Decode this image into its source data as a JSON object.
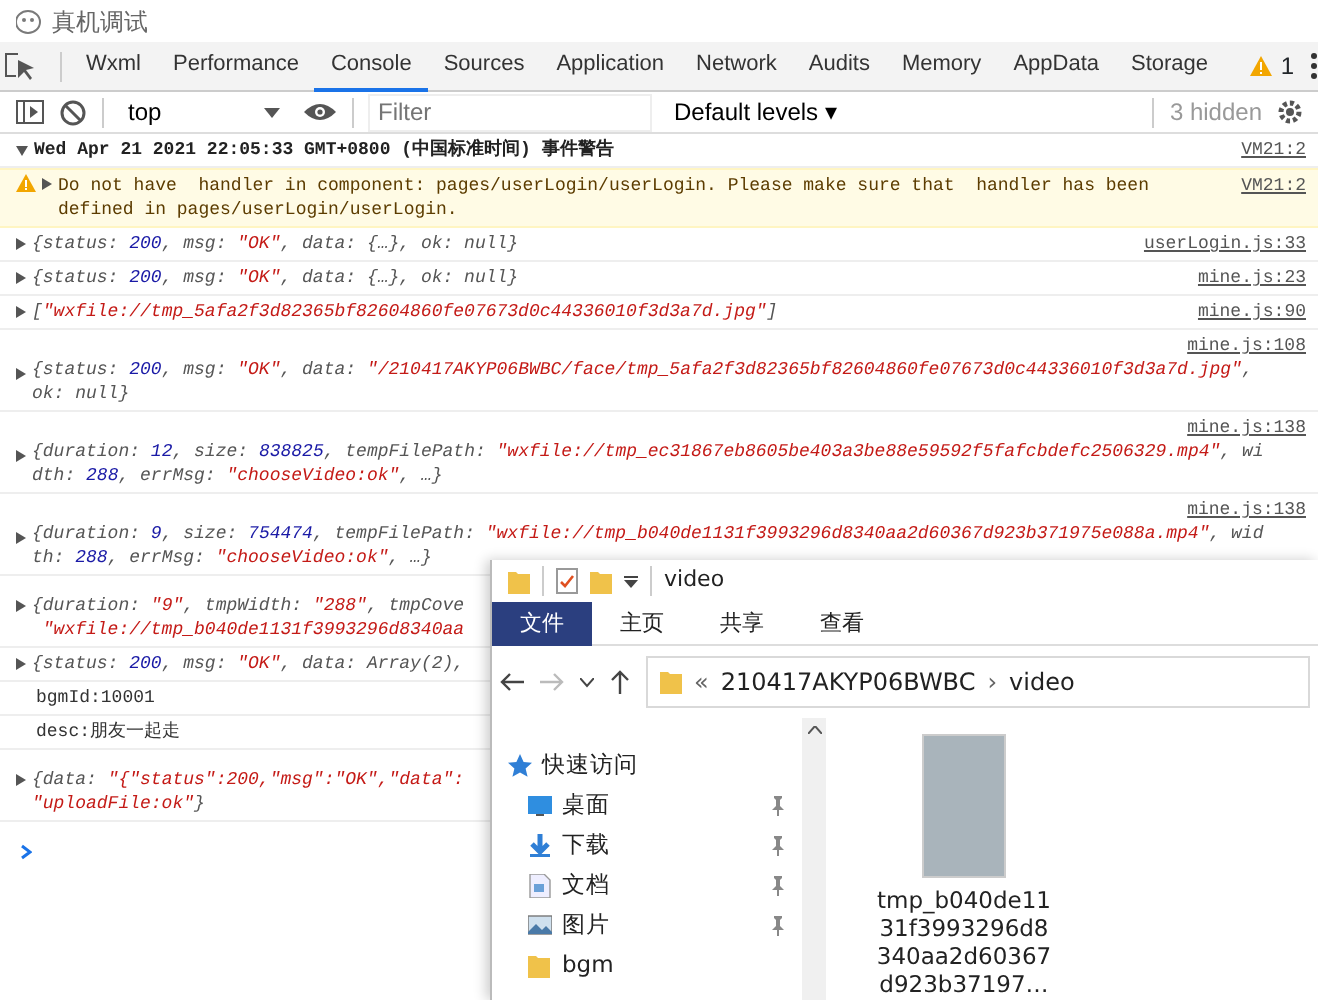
{
  "window": {
    "title": "真机调试"
  },
  "tabs": [
    {
      "label": "Wxml",
      "selected": false
    },
    {
      "label": "Performance",
      "selected": false
    },
    {
      "label": "Console",
      "selected": true
    },
    {
      "label": "Sources",
      "selected": false
    },
    {
      "label": "Application",
      "selected": false
    },
    {
      "label": "Network",
      "selected": false
    },
    {
      "label": "Audits",
      "selected": false
    },
    {
      "label": "Memory",
      "selected": false
    },
    {
      "label": "AppData",
      "selected": false
    },
    {
      "label": "Storage",
      "selected": false
    }
  ],
  "warning_count": "1",
  "toolbar": {
    "context": "top",
    "filter_placeholder": "Filter",
    "levels": "Default levels ▾",
    "hidden": "3 hidden"
  },
  "console": [
    {
      "kind": "group",
      "expanded": true,
      "source": "VM21:2",
      "lines": [
        [
          {
            "kind": "plain",
            "text": "Wed Apr 21 2021 22:05:33 GMT+0800 (中国标准时间) 事件警告"
          }
        ]
      ]
    },
    {
      "kind": "warning",
      "expanded": false,
      "source": "VM21:2",
      "lines": [
        [
          {
            "kind": "plain",
            "text": "Do not have  handler in component: pages/userLogin/userLogin. Please make sure that  handler has been"
          }
        ],
        [
          {
            "kind": "plain",
            "text": "defined in pages/userLogin/userLogin."
          }
        ]
      ]
    },
    {
      "kind": "object",
      "expanded": false,
      "source": "userLogin.js:33",
      "lines": [
        [
          {
            "kind": "plain",
            "text": "{status: "
          },
          {
            "kind": "number",
            "text": "200"
          },
          {
            "kind": "plain",
            "text": ", msg: "
          },
          {
            "kind": "string",
            "text": "\"OK\""
          },
          {
            "kind": "plain",
            "text": ", data: {…}, ok: null}"
          }
        ]
      ]
    },
    {
      "kind": "object",
      "expanded": false,
      "source": "mine.js:23",
      "lines": [
        [
          {
            "kind": "plain",
            "text": "{status: "
          },
          {
            "kind": "number",
            "text": "200"
          },
          {
            "kind": "plain",
            "text": ", msg: "
          },
          {
            "kind": "string",
            "text": "\"OK\""
          },
          {
            "kind": "plain",
            "text": ", data: {…}, ok: null}"
          }
        ]
      ]
    },
    {
      "kind": "object",
      "expanded": false,
      "source": "mine.js:90",
      "lines": [
        [
          {
            "kind": "plain",
            "text": "["
          },
          {
            "kind": "string",
            "text": "\"wxfile://tmp_5afa2f3d82365bf82604860fe07673d0c44336010f3d3a7d.jpg\""
          },
          {
            "kind": "plain",
            "text": "]"
          }
        ]
      ]
    },
    {
      "kind": "wrapped",
      "expanded": false,
      "source": "mine.js:108",
      "lines": [
        [
          {
            "kind": "plain",
            "text": "{status: "
          },
          {
            "kind": "number",
            "text": "200"
          },
          {
            "kind": "plain",
            "text": ", msg: "
          },
          {
            "kind": "string",
            "text": "\"OK\""
          },
          {
            "kind": "plain",
            "text": ", data: "
          },
          {
            "kind": "string",
            "text": "\"/210417AKYP06BWBC/face/tmp_5afa2f3d82365bf82604860fe07673d0c44336010f3d3a7d.jpg\""
          },
          {
            "kind": "plain",
            "text": ","
          }
        ],
        [
          {
            "kind": "plain",
            "text": "ok: null}"
          }
        ]
      ]
    },
    {
      "kind": "wrapped",
      "expanded": false,
      "source": "mine.js:138",
      "lines": [
        [
          {
            "kind": "plain",
            "text": "{duration: "
          },
          {
            "kind": "number",
            "text": "12"
          },
          {
            "kind": "plain",
            "text": ", size: "
          },
          {
            "kind": "number",
            "text": "838825"
          },
          {
            "kind": "plain",
            "text": ", tempFilePath: "
          },
          {
            "kind": "string",
            "text": "\"wxfile://tmp_ec31867eb8605be403a3be88e59592f5fafcbdefc2506329.mp4\""
          },
          {
            "kind": "plain",
            "text": ", wi"
          }
        ],
        [
          {
            "kind": "plain",
            "text": "dth: "
          },
          {
            "kind": "number",
            "text": "288"
          },
          {
            "kind": "plain",
            "text": ", errMsg: "
          },
          {
            "kind": "string",
            "text": "\"chooseVideo:ok\""
          },
          {
            "kind": "plain",
            "text": ", …}"
          }
        ]
      ]
    },
    {
      "kind": "wrapped",
      "expanded": false,
      "source": "mine.js:138",
      "lines": [
        [
          {
            "kind": "plain",
            "text": "{duration: "
          },
          {
            "kind": "number",
            "text": "9"
          },
          {
            "kind": "plain",
            "text": ", size: "
          },
          {
            "kind": "number",
            "text": "754474"
          },
          {
            "kind": "plain",
            "text": ", tempFilePath: "
          },
          {
            "kind": "string",
            "text": "\"wxfile://tmp_b040de1131f3993296d8340aa2d60367d923b371975e088a.mp4\""
          },
          {
            "kind": "plain",
            "text": ", wid"
          }
        ],
        [
          {
            "kind": "plain",
            "text": "th: "
          },
          {
            "kind": "number",
            "text": "288"
          },
          {
            "kind": "plain",
            "text": ", errMsg: "
          },
          {
            "kind": "string",
            "text": "\"chooseVideo:ok\""
          },
          {
            "kind": "plain",
            "text": ", …}"
          }
        ]
      ]
    },
    {
      "kind": "spaced",
      "expanded": false,
      "lines": [
        [
          {
            "kind": "plain",
            "text": "{duration: "
          },
          {
            "kind": "string",
            "text": "\"9\""
          },
          {
            "kind": "plain",
            "text": ", tmpWidth: "
          },
          {
            "kind": "string",
            "text": "\"288\""
          },
          {
            "kind": "plain",
            "text": ", tmpCove"
          }
        ],
        [
          {
            "kind": "string",
            "text": " \"wxfile://tmp_b040de1131f3993296d8340aa"
          }
        ]
      ]
    },
    {
      "kind": "object",
      "expanded": false,
      "lines": [
        [
          {
            "kind": "plain",
            "text": "{status: "
          },
          {
            "kind": "number",
            "text": "200"
          },
          {
            "kind": "plain",
            "text": ", msg: "
          },
          {
            "kind": "string",
            "text": "\"OK\""
          },
          {
            "kind": "plain",
            "text": ", data: Array(2),"
          }
        ]
      ]
    },
    {
      "kind": "text",
      "lines": [
        [
          {
            "kind": "plain",
            "text": "bgmId:10001"
          }
        ]
      ]
    },
    {
      "kind": "text",
      "lines": [
        [
          {
            "kind": "plain",
            "text": "desc:朋友一起走"
          }
        ]
      ]
    },
    {
      "kind": "spaced",
      "expanded": false,
      "lines": [
        [
          {
            "kind": "plain",
            "text": "{data: "
          },
          {
            "kind": "string",
            "text": "\"{\"status\":200,\"msg\":\"OK\",\"data\":"
          }
        ],
        [
          {
            "kind": "string",
            "text": "\"uploadFile:ok\""
          },
          {
            "kind": "plain",
            "text": "}"
          }
        ]
      ]
    }
  ],
  "explorer": {
    "title": "video",
    "ribbon": [
      {
        "label": "文件",
        "selected": true
      },
      {
        "label": "主页",
        "selected": false
      },
      {
        "label": "共享",
        "selected": false
      },
      {
        "label": "查看",
        "selected": false
      }
    ],
    "path": [
      {
        "kind": "more",
        "text": "«"
      },
      {
        "kind": "folder",
        "text": "210417AKYP06BWBC"
      },
      {
        "kind": "sep",
        "text": "›"
      },
      {
        "kind": "folder",
        "text": "video"
      }
    ],
    "nav": [
      {
        "kind": "star",
        "label": "快速访问",
        "pinned": false
      },
      {
        "kind": "desktop",
        "label": "桌面",
        "pinned": true
      },
      {
        "kind": "download",
        "label": "下载",
        "pinned": true
      },
      {
        "kind": "document",
        "label": "文档",
        "pinned": true
      },
      {
        "kind": "picture",
        "label": "图片",
        "pinned": true
      },
      {
        "kind": "folder",
        "label": "bgm",
        "pinned": false
      }
    ],
    "files": [
      {
        "name": "tmp_b040de1131f3993296d8340aa2d60367d923b37197…"
      }
    ]
  }
}
